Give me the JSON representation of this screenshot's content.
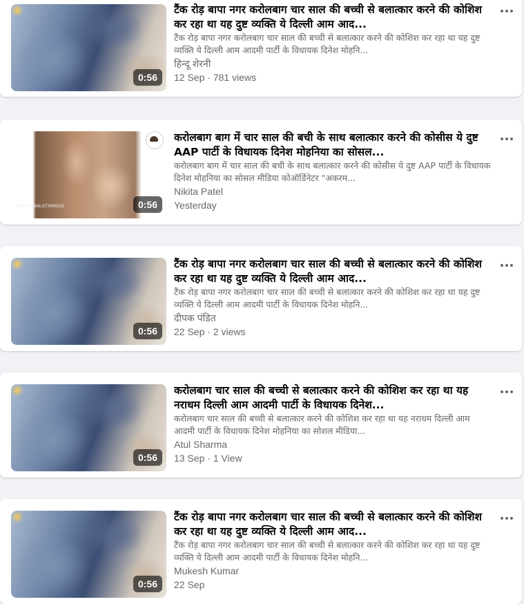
{
  "posts": [
    {
      "title": "टैंक रोड़ बापा नगर करोलबाग चार साल की बच्ची से बलात्कार करने की कोशिश कर रहा था यह दुष्ट व्यक्ति ये दिल्ली आम आद...",
      "snippet": "टैंक रोड़ बापा नगर करोलबाग चार साल की बच्ची से बलात्कार करने की कोशिश कर रहा था यह दुष्ट व्यक्ति ये दिल्ली आम आदमी पार्टी के विधायक दिनेश मोहनि...",
      "author": "हिन्दू शेरनी",
      "meta": "12 Sep · 781 views",
      "duration": "0:56",
      "thumb_variant": "v1"
    },
    {
      "title": "करोलबाग बाग में चार साल की बची के साथ बलात्कार करने की कोसीस ये दुष्ट AAP पार्टी के विधायक दिनेश मोहनिया का सोसल...",
      "snippet": "करोलबाग बाग में चार साल की बची के साथ बलात्कार करने की कोसीस ये दुष्ट AAP पार्टी के विधायक दिनेश मोहनिया का सोसल मीडिया कोऑर्डिनेटर \"अकरम...",
      "author": "Nikita Patel",
      "meta": "Yesterday",
      "duration": "0:56",
      "thumb_variant": "v2",
      "watermark": "@NATIONALISTHINDUS"
    },
    {
      "title": "टैंक रोड़ बापा नगर करोलबाग चार साल की बच्ची से बलात्कार करने की कोशिश कर रहा था यह दुष्ट व्यक्ति ये दिल्ली आम आद...",
      "snippet": "टैंक रोड़ बापा नगर करोलबाग चार साल की बच्ची से बलात्कार करने की कोशिश कर रहा था यह दुष्ट व्यक्ति ये दिल्ली आम आदमी पार्टी के विधायक दिनेश मोहनि...",
      "author": "दीपक पंडित",
      "meta": "22 Sep · 2 views",
      "duration": "0:56",
      "thumb_variant": "v1"
    },
    {
      "title": "करोलबाग चार साल की बच्ची से बलात्कार करने की कोशिश कर रहा था यह नराधम दिल्ली आम आदमी पार्टी के विधायक दिनेश...",
      "snippet": "करोलबाग चार साल की बच्ची से बलात्कार करने की कोशिश कर रहा था यह नराधम दिल्ली आम आदमी पार्टी के विधायक दिनेश मोहनिया का सोशल मीडिया...",
      "author": "Atul Sharma",
      "meta": "13 Sep · 1 View",
      "duration": "0:56",
      "thumb_variant": "v1"
    },
    {
      "title": "टैंक रोड़ बापा नगर करोलबाग चार साल की बच्ची से बलात्कार करने की कोशिश कर रहा था यह दुष्ट व्यक्ति ये दिल्ली आम आद...",
      "snippet": "टैंक रोड़ बापा नगर करोलबाग चार साल की बच्ची से बलात्कार करने की कोशिश कर रहा था यह दुष्ट व्यक्ति ये दिल्ली आम आदमी पार्टी के विधायक दिनेश मोहनि...",
      "author": "Mukesh Kumar",
      "meta": "22 Sep",
      "duration": "0:56",
      "thumb_variant": "v1"
    }
  ]
}
